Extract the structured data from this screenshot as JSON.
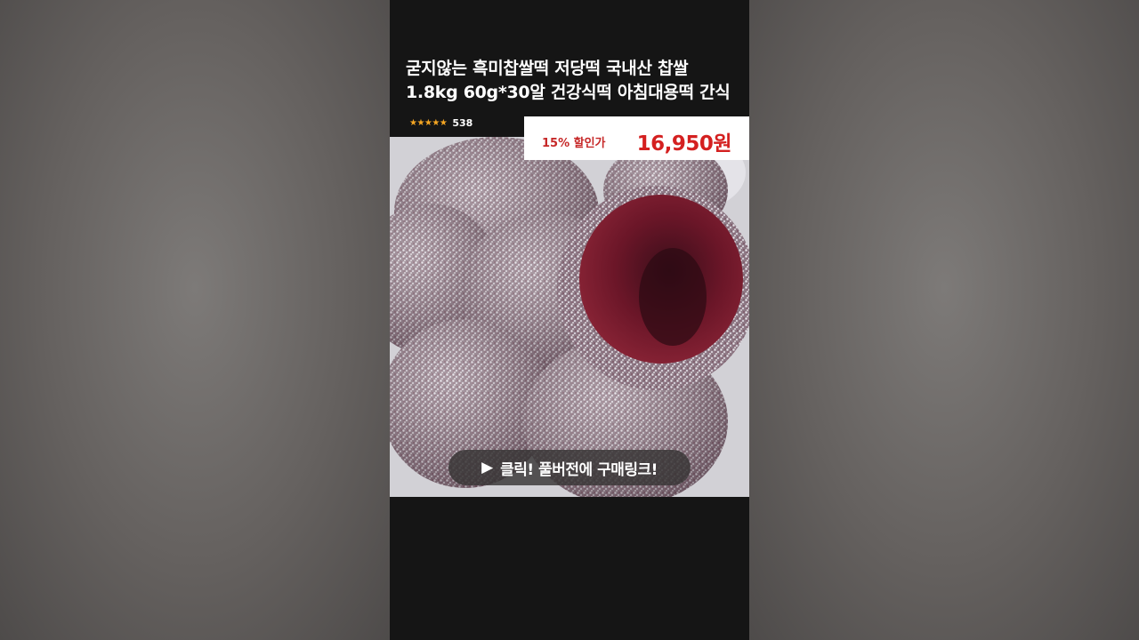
{
  "product": {
    "title_line1": "굳지않는 흑미찹쌀떡 저당떡 국내산 찹쌀",
    "title_line2": "1.8kg 60g*30알 건강식떡 아침대용떡 간식",
    "stars": "★★★★★",
    "rating_value": 5,
    "review_count": "538"
  },
  "price": {
    "discount_label": "15% 할인가",
    "value": "16,950원"
  },
  "cta": {
    "icon": "▶",
    "label": "클릭! 풀버전에 구매링크!"
  },
  "colors": {
    "price_red": "#d42020",
    "star_gold": "#f5a623",
    "panel_dark": "#151515"
  }
}
